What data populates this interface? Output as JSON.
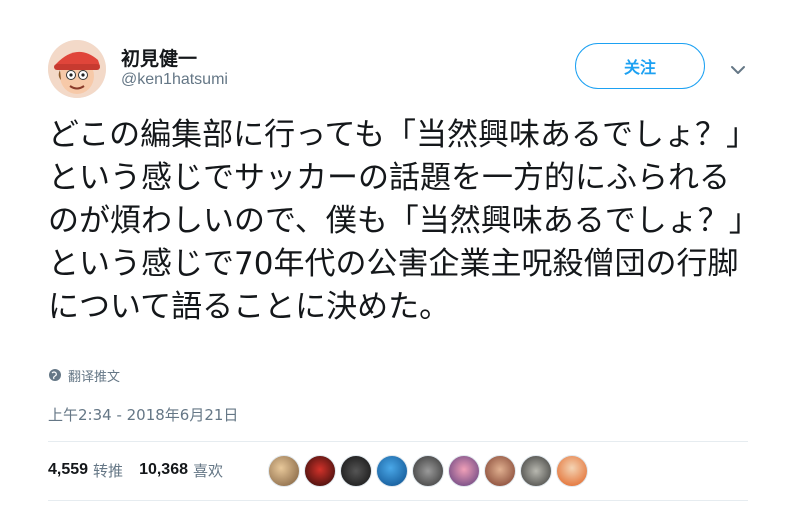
{
  "user": {
    "display_name": "初見健一",
    "handle": "@ken1hatsumi"
  },
  "actions": {
    "follow_label": "关注",
    "more_icon": "chevron-down-icon"
  },
  "tweet": {
    "text": "どこの編集部に行っても「当然興味あるでしょ？」という感じでサッカーの話題を一方的にふられるのが煩わしいので、僕も「当然興味あるでしょ？」という感じで70年代の公害企業主呪殺僧団の行脚について語ることに決めた。",
    "translate_label": "翻译推文",
    "timestamp": "上午2:34 - 2018年6月21日"
  },
  "stats": {
    "retweets_count": "4,559",
    "retweets_label": "转推",
    "likes_count": "10,368",
    "likes_label": "喜欢"
  },
  "colors": {
    "accent": "#1da1f2",
    "secondary_text": "#657786",
    "divider": "#e6ecf0"
  }
}
